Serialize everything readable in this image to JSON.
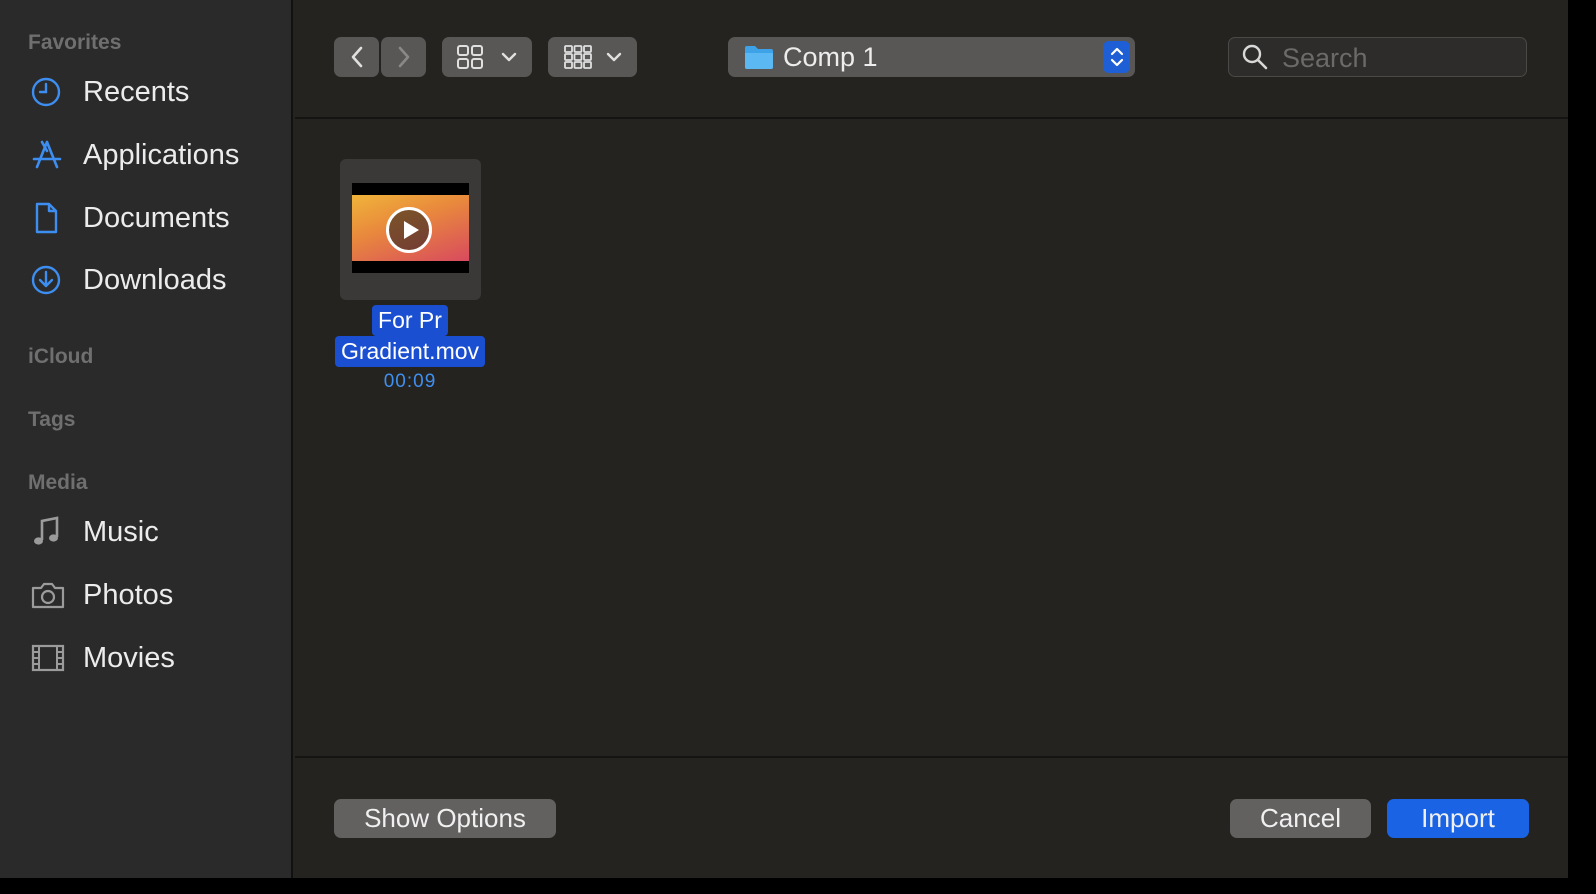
{
  "sidebar": {
    "favorites_title": "Favorites",
    "favorites": [
      {
        "label": "Recents",
        "icon": "clock-icon"
      },
      {
        "label": "Applications",
        "icon": "applications-icon"
      },
      {
        "label": "Documents",
        "icon": "document-icon"
      },
      {
        "label": "Downloads",
        "icon": "download-icon"
      }
    ],
    "icloud_title": "iCloud",
    "tags_title": "Tags",
    "media_title": "Media",
    "media": [
      {
        "label": "Music",
        "icon": "music-note-icon"
      },
      {
        "label": "Photos",
        "icon": "camera-icon"
      },
      {
        "label": "Movies",
        "icon": "film-icon"
      }
    ]
  },
  "toolbar": {
    "location": "Comp 1",
    "search_placeholder": "Search"
  },
  "files": [
    {
      "name_line1": "For Pr",
      "name_line2": "Gradient.mov",
      "duration": "00:09",
      "selected": true
    }
  ],
  "footer": {
    "show_options": "Show Options",
    "cancel": "Cancel",
    "import": "Import"
  },
  "colors": {
    "accent": "#1a63e4",
    "sidebar_icon": "#3d8ef0",
    "selection": "#1a4fd1"
  }
}
